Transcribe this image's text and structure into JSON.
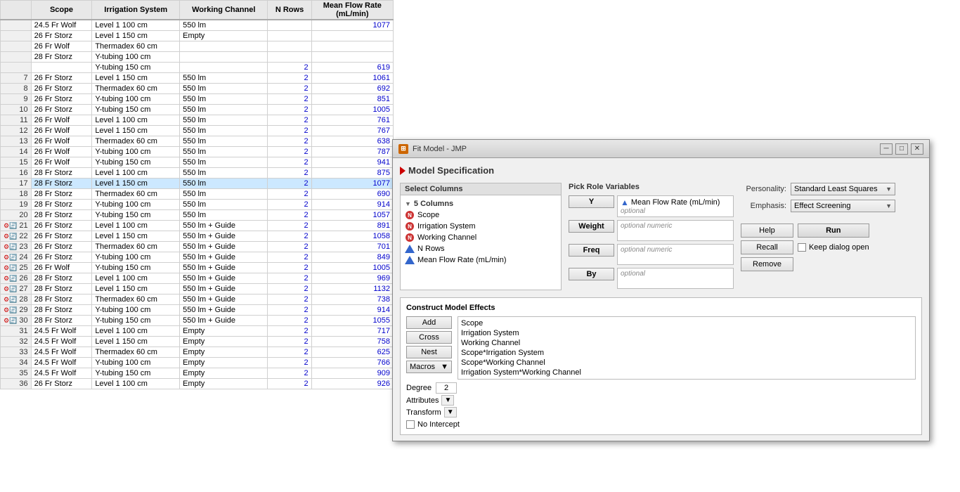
{
  "spreadsheet": {
    "columns": [
      "",
      "Scope",
      "Irrigation System",
      "Working Channel",
      "N Rows",
      "Mean Flow Rate\n(mL/min)"
    ],
    "rows": [
      {
        "num": "",
        "scope": "24.5 Fr Wolf",
        "irrigation": "Level 1 100 cm",
        "channel": "550 lm",
        "nrows": "",
        "flow": "1077",
        "icons": false,
        "selected": false
      },
      {
        "num": "",
        "scope": "26 Fr Storz",
        "irrigation": "Level 1 150 cm",
        "channel": "Empty",
        "nrows": "",
        "flow": "",
        "icons": false,
        "selected": false
      },
      {
        "num": "",
        "scope": "26 Fr Wolf",
        "irrigation": "Thermadex 60 cm",
        "channel": "",
        "nrows": "",
        "flow": "",
        "icons": false,
        "selected": false
      },
      {
        "num": "",
        "scope": "28 Fr Storz",
        "irrigation": "Y-tubing 100 cm",
        "channel": "",
        "nrows": "",
        "flow": "",
        "icons": false,
        "selected": false
      },
      {
        "num": "",
        "scope": "",
        "irrigation": "Y-tubing 150 cm",
        "channel": "",
        "nrows": "2",
        "flow": "619",
        "icons": false,
        "selected": false
      },
      {
        "num": "7",
        "scope": "26 Fr Storz",
        "irrigation": "Level 1 150 cm",
        "channel": "550 lm",
        "nrows": "2",
        "flow": "1061",
        "icons": false,
        "selected": false
      },
      {
        "num": "8",
        "scope": "26 Fr Storz",
        "irrigation": "Thermadex 60 cm",
        "channel": "550 lm",
        "nrows": "2",
        "flow": "692",
        "icons": false,
        "selected": false
      },
      {
        "num": "9",
        "scope": "26 Fr Storz",
        "irrigation": "Y-tubing 100 cm",
        "channel": "550 lm",
        "nrows": "2",
        "flow": "851",
        "icons": false,
        "selected": false
      },
      {
        "num": "10",
        "scope": "26 Fr Storz",
        "irrigation": "Y-tubing 150 cm",
        "channel": "550 lm",
        "nrows": "2",
        "flow": "1005",
        "icons": false,
        "selected": false
      },
      {
        "num": "11",
        "scope": "26 Fr Wolf",
        "irrigation": "Level 1 100 cm",
        "channel": "550 lm",
        "nrows": "2",
        "flow": "761",
        "icons": false,
        "selected": false
      },
      {
        "num": "12",
        "scope": "26 Fr Wolf",
        "irrigation": "Level 1 150 cm",
        "channel": "550 lm",
        "nrows": "2",
        "flow": "767",
        "icons": false,
        "selected": false
      },
      {
        "num": "13",
        "scope": "26 Fr Wolf",
        "irrigation": "Thermadex 60 cm",
        "channel": "550 lm",
        "nrows": "2",
        "flow": "638",
        "icons": false,
        "selected": false
      },
      {
        "num": "14",
        "scope": "26 Fr Wolf",
        "irrigation": "Y-tubing 100 cm",
        "channel": "550 lm",
        "nrows": "2",
        "flow": "787",
        "icons": false,
        "selected": false
      },
      {
        "num": "15",
        "scope": "26 Fr Wolf",
        "irrigation": "Y-tubing 150 cm",
        "channel": "550 lm",
        "nrows": "2",
        "flow": "941",
        "icons": false,
        "selected": false
      },
      {
        "num": "16",
        "scope": "28 Fr Storz",
        "irrigation": "Level 1 100 cm",
        "channel": "550 lm",
        "nrows": "2",
        "flow": "875",
        "icons": false,
        "selected": false
      },
      {
        "num": "17",
        "scope": "28 Fr Storz",
        "irrigation": "Level 1 150 cm",
        "channel": "550 lm",
        "nrows": "2",
        "flow": "1077",
        "icons": false,
        "selected": true
      },
      {
        "num": "18",
        "scope": "28 Fr Storz",
        "irrigation": "Thermadex 60 cm",
        "channel": "550 lm",
        "nrows": "2",
        "flow": "690",
        "icons": false,
        "selected": false
      },
      {
        "num": "19",
        "scope": "28 Fr Storz",
        "irrigation": "Y-tubing 100 cm",
        "channel": "550 lm",
        "nrows": "2",
        "flow": "914",
        "icons": false,
        "selected": false
      },
      {
        "num": "20",
        "scope": "28 Fr Storz",
        "irrigation": "Y-tubing 150 cm",
        "channel": "550 lm",
        "nrows": "2",
        "flow": "1057",
        "icons": false,
        "selected": false
      },
      {
        "num": "21",
        "scope": "26 Fr Storz",
        "irrigation": "Level 1 100 cm",
        "channel": "550 lm + Guide",
        "nrows": "2",
        "flow": "891",
        "icons": true,
        "selected": false
      },
      {
        "num": "22",
        "scope": "26 Fr Storz",
        "irrigation": "Level 1 150 cm",
        "channel": "550 lm + Guide",
        "nrows": "2",
        "flow": "1058",
        "icons": true,
        "selected": false
      },
      {
        "num": "23",
        "scope": "26 Fr Storz",
        "irrigation": "Thermadex 60 cm",
        "channel": "550 lm + Guide",
        "nrows": "2",
        "flow": "701",
        "icons": true,
        "selected": false
      },
      {
        "num": "24",
        "scope": "26 Fr Storz",
        "irrigation": "Y-tubing 100 cm",
        "channel": "550 lm + Guide",
        "nrows": "2",
        "flow": "849",
        "icons": true,
        "selected": false
      },
      {
        "num": "25",
        "scope": "26 Fr Wolf",
        "irrigation": "Y-tubing 150 cm",
        "channel": "550 lm + Guide",
        "nrows": "2",
        "flow": "1005",
        "icons": true,
        "selected": false
      },
      {
        "num": "26",
        "scope": "28 Fr Storz",
        "irrigation": "Level 1 100 cm",
        "channel": "550 lm + Guide",
        "nrows": "2",
        "flow": "969",
        "icons": true,
        "selected": false
      },
      {
        "num": "27",
        "scope": "28 Fr Storz",
        "irrigation": "Level 1 150 cm",
        "channel": "550 lm + Guide",
        "nrows": "2",
        "flow": "1132",
        "icons": true,
        "selected": false
      },
      {
        "num": "28",
        "scope": "28 Fr Storz",
        "irrigation": "Thermadex 60 cm",
        "channel": "550 lm + Guide",
        "nrows": "2",
        "flow": "738",
        "icons": true,
        "selected": false
      },
      {
        "num": "29",
        "scope": "28 Fr Storz",
        "irrigation": "Y-tubing 100 cm",
        "channel": "550 lm + Guide",
        "nrows": "2",
        "flow": "914",
        "icons": true,
        "selected": false
      },
      {
        "num": "30",
        "scope": "28 Fr Storz",
        "irrigation": "Y-tubing 150 cm",
        "channel": "550 lm + Guide",
        "nrows": "2",
        "flow": "1055",
        "icons": true,
        "selected": false
      },
      {
        "num": "31",
        "scope": "24.5 Fr Wolf",
        "irrigation": "Level 1 100 cm",
        "channel": "Empty",
        "nrows": "2",
        "flow": "717",
        "icons": false,
        "selected": false
      },
      {
        "num": "32",
        "scope": "24.5 Fr Wolf",
        "irrigation": "Level 1 150 cm",
        "channel": "Empty",
        "nrows": "2",
        "flow": "758",
        "icons": false,
        "selected": false
      },
      {
        "num": "33",
        "scope": "24.5 Fr Wolf",
        "irrigation": "Thermadex 60 cm",
        "channel": "Empty",
        "nrows": "2",
        "flow": "625",
        "icons": false,
        "selected": false
      },
      {
        "num": "34",
        "scope": "24.5 Fr Wolf",
        "irrigation": "Y-tubing 100 cm",
        "channel": "Empty",
        "nrows": "2",
        "flow": "766",
        "icons": false,
        "selected": false
      },
      {
        "num": "35",
        "scope": "24.5 Fr Wolf",
        "irrigation": "Y-tubing 150 cm",
        "channel": "Empty",
        "nrows": "2",
        "flow": "909",
        "icons": false,
        "selected": false
      },
      {
        "num": "36",
        "scope": "26 Fr Storz",
        "irrigation": "Level 1 100 cm",
        "channel": "Empty",
        "nrows": "2",
        "flow": "926",
        "icons": false,
        "selected": false
      }
    ]
  },
  "dialog": {
    "title": "Fit Model - JMP",
    "section_title": "Model Specification",
    "select_columns": {
      "header": "Select Columns",
      "count_label": "5 Columns",
      "items": [
        {
          "name": "Scope",
          "type": "nominal"
        },
        {
          "name": "Irrigation System",
          "type": "nominal"
        },
        {
          "name": "Working Channel",
          "type": "nominal"
        },
        {
          "name": "N Rows",
          "type": "continuous"
        },
        {
          "name": "Mean Flow Rate (mL/min)",
          "type": "continuous"
        }
      ]
    },
    "pick_role": {
      "header": "Pick Role Variables",
      "y_label": "Y",
      "y_value": "Mean Flow Rate (mL/min)",
      "y_optional": "optional",
      "weight_label": "Weight",
      "weight_placeholder": "optional numeric",
      "freq_label": "Freq",
      "freq_placeholder": "optional numeric",
      "by_label": "By",
      "by_placeholder": "optional"
    },
    "personality": {
      "label": "Personality:",
      "value": "Standard Least Squares",
      "emphasis_label": "Emphasis:",
      "emphasis_value": "Effect Screening"
    },
    "action_buttons": {
      "help": "Help",
      "run": "Run",
      "recall": "Recall",
      "remove": "Remove",
      "keep_dialog": "Keep dialog open"
    },
    "construct": {
      "header": "Construct Model Effects",
      "add": "Add",
      "cross": "Cross",
      "nest": "Nest",
      "macros": "Macros",
      "degree_label": "Degree",
      "degree_value": "2",
      "attributes_label": "Attributes",
      "transform_label": "Transform",
      "no_intercept": "No Intercept",
      "effects": [
        "Scope",
        "Irrigation System",
        "Working Channel",
        "Scope*Irrigation System",
        "Scope*Working Channel",
        "Irrigation System*Working Channel"
      ]
    }
  }
}
